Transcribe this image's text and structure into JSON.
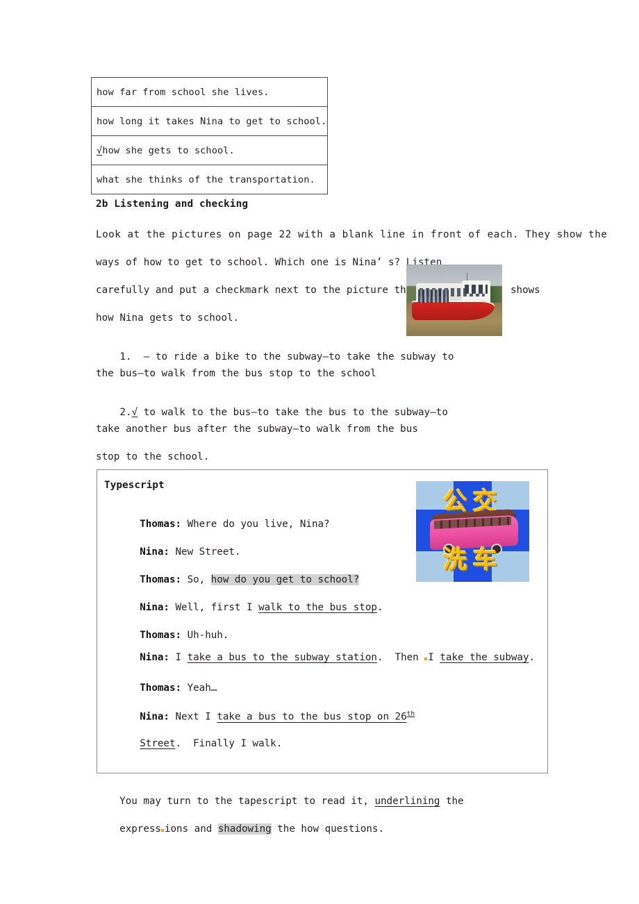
{
  "document": {
    "options_table": {
      "rows": [
        {
          "checked": false,
          "check_mark": "",
          "text": "how far from school she lives."
        },
        {
          "checked": false,
          "check_mark": "",
          "text": "how long it takes Nina to get to school."
        },
        {
          "checked": true,
          "check_mark": "√",
          "text": "how she gets to school."
        },
        {
          "checked": false,
          "check_mark": "",
          "text": "what she thinks of the transportation."
        }
      ]
    },
    "section": {
      "heading": "2b Listening and checking"
    },
    "intro": {
      "line1": "Look at the pictures on page 22 with a blank line in front of each. They show the",
      "line2": "ways of how to get to school. Which one is Nina’ s? Listen",
      "line3": "carefully and put a checkmark next to the picture that",
      "line3_tail": "shows",
      "line4": "how Nina gets to school."
    },
    "boat_image": {
      "alt": "red and white passenger boat on a muddy river"
    },
    "numbered_items": [
      {
        "number": "1.",
        "mark": "—",
        "mark_checked": false,
        "line1": " to ride a bike to the subway—to take the subway to",
        "line2": "the bus—to walk from the bus stop to the school"
      },
      {
        "number": "2.",
        "mark": "√",
        "mark_checked": true,
        "line1": " to walk to the bus—to take the bus to the subway—to",
        "line2": "take another bus after the subway—to walk from the bus",
        "line3": "stop to the school."
      }
    ],
    "typescript": {
      "title": "Typescript",
      "lines": [
        {
          "speaker": "Thomas:",
          "pre": " Where do you live, Nina?",
          "highlight": "",
          "post": ""
        },
        {
          "speaker": "Nina:",
          "pre": " New Street.",
          "highlight": "",
          "post": ""
        },
        {
          "speaker": "Thomas:",
          "pre": " So, ",
          "highlight": "how do you get to school?",
          "post": ""
        },
        {
          "speaker": "Nina:",
          "pre": " Well, first I ",
          "underline": "walk to the bus stop",
          "post": "."
        },
        {
          "speaker": "Thomas:",
          "pre": " Uh-huh.",
          "highlight": "",
          "post": ""
        },
        {
          "speaker": "Nina:",
          "pre": " I ",
          "underline": "take a bus to the subway station",
          "mid": ".  Then ",
          "underline2": "take the subway",
          "post": "."
        },
        {
          "speaker": "Thomas:",
          "pre": " Yeah…",
          "highlight": "",
          "post": ""
        },
        {
          "speaker": "Nina:",
          "pre": " Next I ",
          "underline": "take a bus to the bus stop on 26",
          "superscript": "th",
          "post": ""
        }
      ],
      "last_line_underline": "Street",
      "last_line_rest": ".  Finally I walk.",
      "between_i": "I"
    },
    "bus_image": {
      "chinese_top": "公交",
      "chinese_bottom": "洗车",
      "alt": "pink bus with Chinese characters on blue background"
    },
    "closing": {
      "line1_pre": "You may turn to the tapescript to read it, ",
      "line1_underline": "underlining",
      "line1_post": " the",
      "line2_pre": "express",
      "line2_mid": "ions and ",
      "line2_highlight": "shadowing",
      "line2_post": " the how questions."
    },
    "colors": {
      "text": "#231f20",
      "border": "#4a4a4a",
      "box_border": "#8d8d8d",
      "highlight": "#d2d2d2",
      "mark_orange": "#e8a317"
    }
  }
}
